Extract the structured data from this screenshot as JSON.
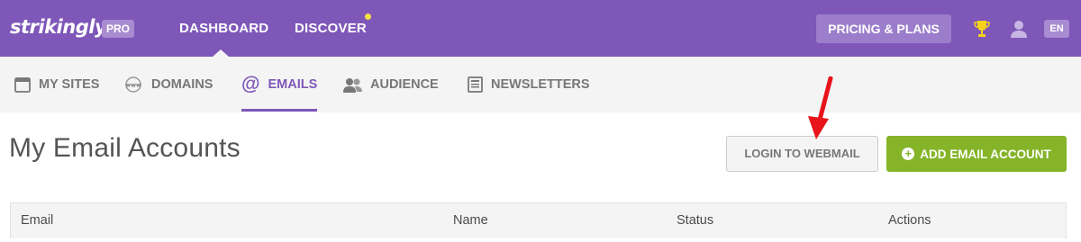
{
  "brand": {
    "logo_text": "strikingly",
    "plan_badge": "PRO"
  },
  "topnav": {
    "dashboard": "DASHBOARD",
    "discover": "DISCOVER",
    "pricing": "PRICING & PLANS",
    "language": "EN"
  },
  "subnav": {
    "tabs": [
      {
        "label": "MY SITES",
        "icon": "browser-window-icon"
      },
      {
        "label": "DOMAINS",
        "icon": "www-globe-icon"
      },
      {
        "label": "EMAILS",
        "icon": "at-sign-icon",
        "active": true
      },
      {
        "label": "AUDIENCE",
        "icon": "people-icon"
      },
      {
        "label": "NEWSLETTERS",
        "icon": "newsletter-icon"
      }
    ]
  },
  "main": {
    "title": "My Email Accounts",
    "login_webmail": "LOGIN TO WEBMAIL",
    "add_email": "ADD EMAIL ACCOUNT"
  },
  "table": {
    "columns": [
      "Email",
      "Name",
      "Status",
      "Actions"
    ]
  },
  "colors": {
    "brand_purple": "#7e57b9",
    "accent_green": "#85b429",
    "annotation_red": "#e8141b"
  }
}
